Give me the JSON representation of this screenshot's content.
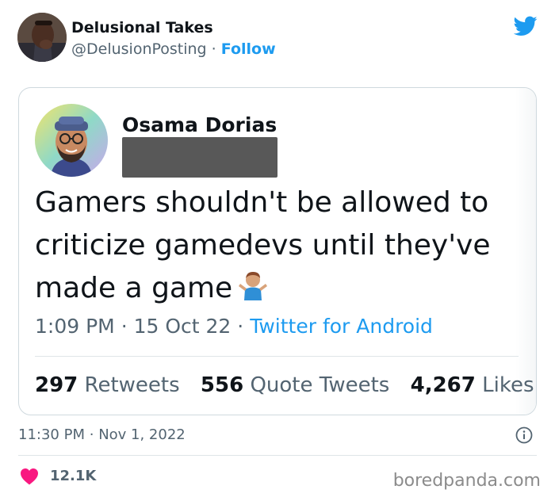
{
  "author": {
    "name": "Delusional Takes",
    "handle": "@DelusionPosting",
    "separator": "·",
    "follow_label": "Follow",
    "avatar_icon": "person-hand-on-mouth-avatar"
  },
  "quoted_tweet": {
    "name": "Osama Dorias",
    "handle_redacted": true,
    "text": "Gamers shouldn't be allowed to criticize gamedevs until they've made a game",
    "emoji": "person-shrugging-emoji",
    "time": "1:09 PM",
    "separator": "·",
    "date": "15 Oct 22",
    "app": "Twitter for Android",
    "retweets_count": "297",
    "retweets_label": "Retweets",
    "quote_count": "556",
    "quote_label": "Quote Tweets",
    "likes_count": "4,267",
    "likes_label": "Likes"
  },
  "tweet": {
    "time": "11:30 PM",
    "separator": "·",
    "date": "Nov 1, 2022",
    "likes": "12.1K"
  },
  "watermark": "boredpanda.com",
  "colors": {
    "accent": "#1d9bf0",
    "text": "#0f1419",
    "muted": "#536471",
    "heart": "#f91880"
  }
}
